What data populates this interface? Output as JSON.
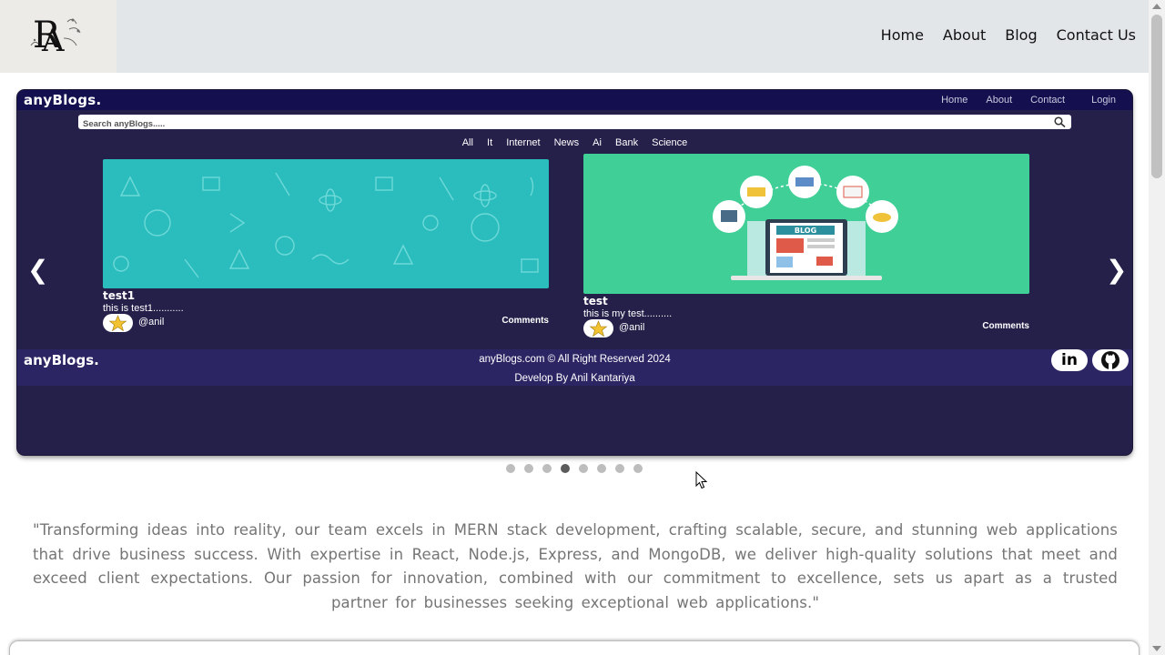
{
  "header": {
    "logo_alt": "RA",
    "nav": [
      "Home",
      "About",
      "Blog",
      "Contact Us"
    ]
  },
  "slide": {
    "brand": "anyBlogs.",
    "nav": [
      "Home",
      "About",
      "Contact",
      "Login"
    ],
    "search_placeholder": "Search anyBlogs.....",
    "categories": [
      "All",
      "It",
      "Internet",
      "News",
      "Ai",
      "Bank",
      "Science"
    ],
    "cards": [
      {
        "title": "test1",
        "description": "this is test1...........",
        "user": "@anil",
        "comments_label": "Comments",
        "image_color": "#2bbdbd"
      },
      {
        "title": "test",
        "description": "this is my test..........",
        "user": "@anil",
        "comments_label": "Comments",
        "image_color": "#40d097"
      }
    ],
    "footer": {
      "brand": "anyBlogs.",
      "copyright": "anyBlogs.com © All Right Reserved 2024",
      "developer": "Develop By Anil Kantariya",
      "social": [
        "in"
      ]
    },
    "illustration_text": "BLOG",
    "prev_arrow": "❮",
    "next_arrow": "❯"
  },
  "carousel": {
    "total_slides": 8,
    "active_index": 3
  },
  "quote": "\"Transforming ideas into reality, our team excels in MERN stack development, crafting scalable, secure, and stunning web applications that drive business success. With expertise in React, Node.js, Express, and MongoDB, we deliver high-quality solutions that meet and exceed client expectations. Our passion for innovation, combined with our commitment to excellence, sets us apart as a trusted partner for businesses seeking exceptional web applications.\"",
  "colors": {
    "header_bg": "#e3e6e9",
    "slide_bg": "#25204a",
    "slide_nav_bg": "#14104f",
    "slide_footer_bg": "#2c2564",
    "quote_text": "#757575",
    "dot_active": "#5a5a5a",
    "dot_inactive": "#bdbdbd"
  }
}
